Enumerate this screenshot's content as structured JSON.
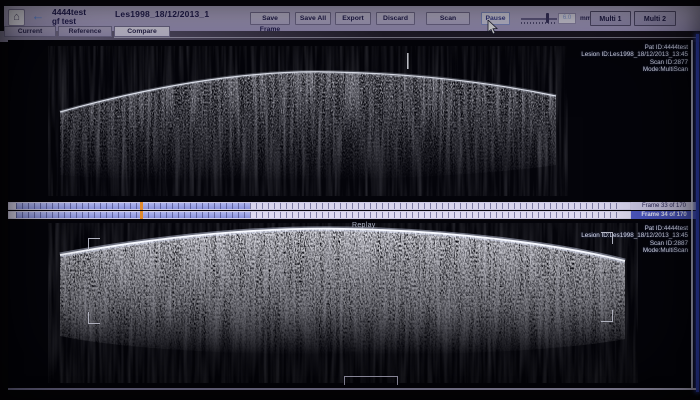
{
  "header": {
    "patient_line1": "4444test",
    "patient_line2": "gf test",
    "study_title": "Les1998_18/12/2013_1"
  },
  "icons": {
    "home": "⌂",
    "back": "←"
  },
  "toolbar": {
    "save_frame": "Save Frame",
    "save_all": "Save All",
    "export": "Export",
    "discard": "Discard",
    "scan": "Scan",
    "pause": "Pause",
    "range_value": "6.0",
    "range_unit": "mm",
    "multi1": "Multi 1",
    "multi2": "Multi 2"
  },
  "tabs": {
    "current": "Current",
    "reference": "Reference",
    "compare": "Compare",
    "active_tab": "Compare"
  },
  "top_panel": {
    "overlay": [
      "Pat ID:4444test",
      "Lesion ID:Les1998_18/12/2013_13:45",
      "Scan ID:2877",
      "Mode:MultiScan"
    ],
    "frame_label": "Frame 33 of 170"
  },
  "bottom_panel": {
    "replay_label": "Replay",
    "overlay": [
      "Pat ID:4444test",
      "Lesion ID:Les1998_18/12/2013_13:45",
      "Scan ID:2887",
      "Mode:MultiScan"
    ],
    "frame_label": "Frame 34 of 170"
  },
  "colors": {
    "toolbar_lavender": "#b3aacf",
    "button_text_navy": "#221d52",
    "highlight_row_blue": "#4d58c2",
    "marker_orange": "#e08a2e",
    "edge_blue": "#3a4fd8"
  }
}
